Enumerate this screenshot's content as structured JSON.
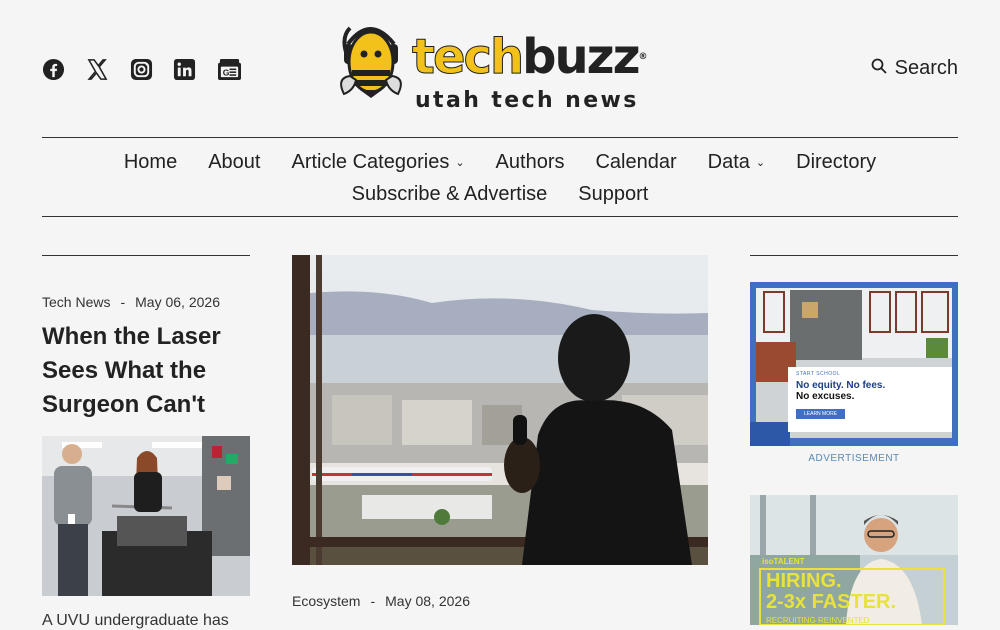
{
  "header": {
    "social_icons": [
      "facebook-icon",
      "x-icon",
      "instagram-icon",
      "linkedin-icon",
      "google-news-icon"
    ],
    "logo": {
      "brand": "techbuzz",
      "tagline": "utah tech news"
    },
    "search_label": "Search"
  },
  "nav": {
    "row1": [
      {
        "label": "Home",
        "dropdown": false
      },
      {
        "label": "About",
        "dropdown": false
      },
      {
        "label": "Article Categories",
        "dropdown": true
      },
      {
        "label": "Authors",
        "dropdown": false
      },
      {
        "label": "Calendar",
        "dropdown": false
      },
      {
        "label": "Data",
        "dropdown": true
      },
      {
        "label": "Directory",
        "dropdown": false
      }
    ],
    "row2": [
      {
        "label": "Subscribe & Advertise",
        "dropdown": false
      },
      {
        "label": "Support",
        "dropdown": false
      }
    ]
  },
  "left_article": {
    "category": "Tech News",
    "separator": "-",
    "date": "May 06, 2026",
    "title": "When the Laser Sees What the Surgeon Can't",
    "excerpt": "A UVU undergraduate has"
  },
  "center_article": {
    "category": "Ecosystem",
    "separator": "-",
    "date": "May 08, 2026"
  },
  "ads": {
    "ad1": {
      "kicker": "START SCHOOL",
      "line1": "No equity. No fees.",
      "line2": "No excuses.",
      "button": "LEARN MORE",
      "label": "ADVERTISEMENT"
    },
    "ad2": {
      "brand": "isoTALENT",
      "line1": "HIRING.",
      "line2": "2-3x FASTER.",
      "line3": "RECRUITING REINVENTED"
    }
  },
  "colors": {
    "logo_yellow": "#f2c21b",
    "ad_blue": "#3f6fc0",
    "ad_label": "#5a8ab4",
    "ad2_yellow": "#e8e23a"
  }
}
